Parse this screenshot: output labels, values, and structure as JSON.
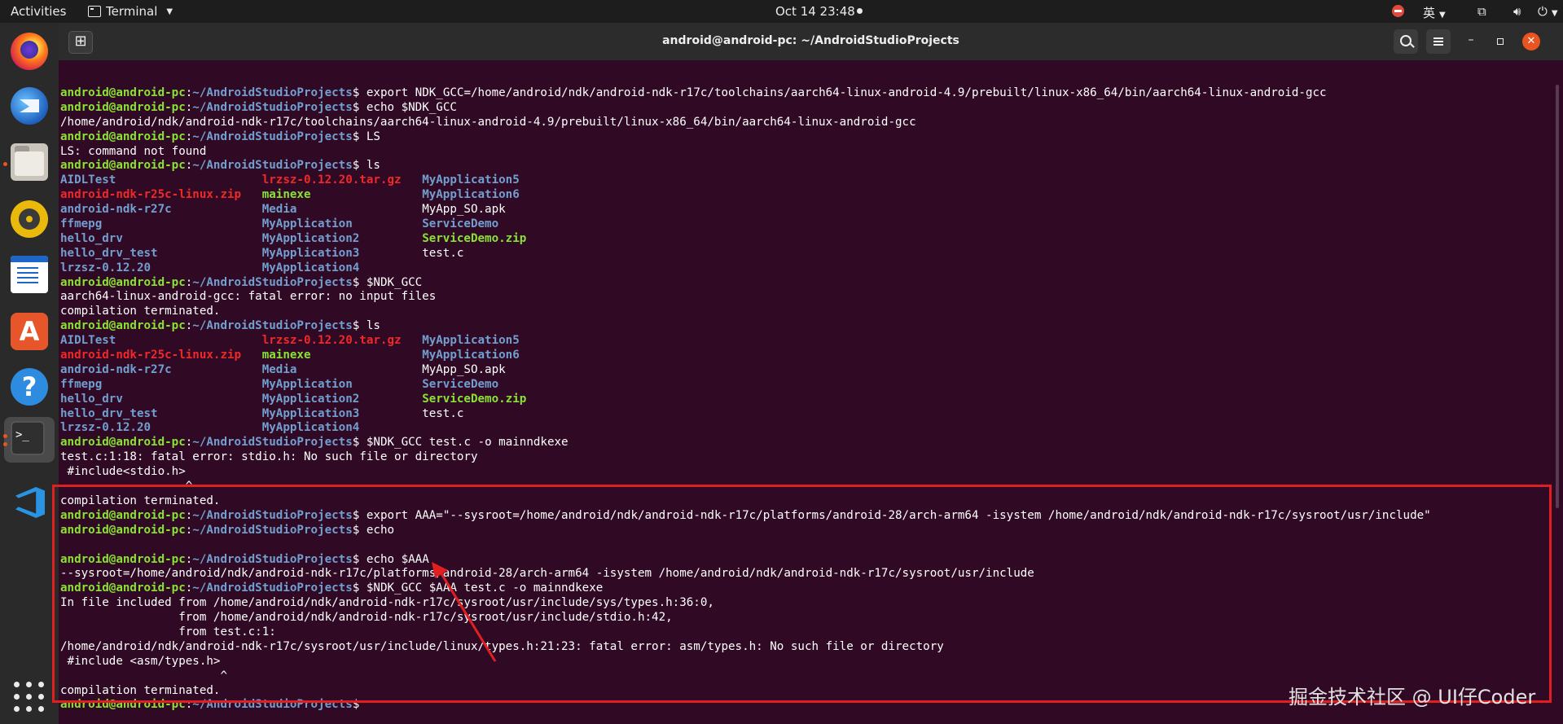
{
  "topbar": {
    "activities": "Activities",
    "app_name": "Terminal",
    "clock": "Oct 14  23:48",
    "ime": "英"
  },
  "dock": {
    "items": [
      "firefox",
      "thunderbird",
      "files",
      "rhythmbox",
      "libreoffice-writer",
      "ubuntu-software",
      "help",
      "terminal",
      "vscode",
      "show-applications"
    ]
  },
  "window": {
    "title": "android@android-pc: ~/AndroidStudioProjects"
  },
  "prompt": {
    "user": "android@android-pc",
    "sep": ":",
    "path": "~/AndroidStudioProjects",
    "dollar": "$ "
  },
  "terminal": {
    "lines": [
      {
        "kind": "prompt",
        "cmd": "export NDK_GCC=/home/android/ndk/android-ndk-r17c/toolchains/aarch64-linux-android-4.9/prebuilt/linux-x86_64/bin/aarch64-linux-android-gcc"
      },
      {
        "kind": "prompt",
        "cmd": "echo $NDK_GCC"
      },
      {
        "kind": "out",
        "text": "/home/android/ndk/android-ndk-r17c/toolchains/aarch64-linux-android-4.9/prebuilt/linux-x86_64/bin/aarch64-linux-android-gcc"
      },
      {
        "kind": "prompt",
        "cmd": "LS"
      },
      {
        "kind": "out",
        "text": "LS: command not found"
      },
      {
        "kind": "prompt",
        "cmd": "ls"
      },
      {
        "kind": "cols",
        "cells": [
          [
            "AIDLTest",
            "dir"
          ],
          [
            "lrzsz-0.12.20.tar.gz",
            "arc"
          ],
          [
            "MyApplication5",
            "dir"
          ]
        ]
      },
      {
        "kind": "cols",
        "cells": [
          [
            "android-ndk-r25c-linux.zip",
            "arc"
          ],
          [
            "mainexe",
            "exe"
          ],
          [
            "MyApplication6",
            "dir"
          ]
        ]
      },
      {
        "kind": "cols",
        "cells": [
          [
            "android-ndk-r27c",
            "dir"
          ],
          [
            "Media",
            "dir"
          ],
          [
            "MyApp_SO.apk",
            "plain"
          ]
        ]
      },
      {
        "kind": "cols",
        "cells": [
          [
            "ffmepg",
            "dir"
          ],
          [
            "MyApplication",
            "dir"
          ],
          [
            "ServiceDemo",
            "dir"
          ]
        ]
      },
      {
        "kind": "cols",
        "cells": [
          [
            "hello_drv",
            "dir"
          ],
          [
            "MyApplication2",
            "dir"
          ],
          [
            "ServiceDemo.zip",
            "exe"
          ]
        ]
      },
      {
        "kind": "cols",
        "cells": [
          [
            "hello_drv_test",
            "dir"
          ],
          [
            "MyApplication3",
            "dir"
          ],
          [
            "test.c",
            "plain"
          ]
        ]
      },
      {
        "kind": "cols",
        "cells": [
          [
            "lrzsz-0.12.20",
            "dir"
          ],
          [
            "MyApplication4",
            "dir"
          ]
        ]
      },
      {
        "kind": "prompt",
        "cmd": "$NDK_GCC"
      },
      {
        "kind": "out",
        "text": "aarch64-linux-android-gcc: fatal error: no input files"
      },
      {
        "kind": "out",
        "text": "compilation terminated."
      },
      {
        "kind": "prompt",
        "cmd": "ls"
      },
      {
        "kind": "cols",
        "cells": [
          [
            "AIDLTest",
            "dir"
          ],
          [
            "lrzsz-0.12.20.tar.gz",
            "arc"
          ],
          [
            "MyApplication5",
            "dir"
          ]
        ]
      },
      {
        "kind": "cols",
        "cells": [
          [
            "android-ndk-r25c-linux.zip",
            "arc"
          ],
          [
            "mainexe",
            "exe"
          ],
          [
            "MyApplication6",
            "dir"
          ]
        ]
      },
      {
        "kind": "cols",
        "cells": [
          [
            "android-ndk-r27c",
            "dir"
          ],
          [
            "Media",
            "dir"
          ],
          [
            "MyApp_SO.apk",
            "plain"
          ]
        ]
      },
      {
        "kind": "cols",
        "cells": [
          [
            "ffmepg",
            "dir"
          ],
          [
            "MyApplication",
            "dir"
          ],
          [
            "ServiceDemo",
            "dir"
          ]
        ]
      },
      {
        "kind": "cols",
        "cells": [
          [
            "hello_drv",
            "dir"
          ],
          [
            "MyApplication2",
            "dir"
          ],
          [
            "ServiceDemo.zip",
            "exe"
          ]
        ]
      },
      {
        "kind": "cols",
        "cells": [
          [
            "hello_drv_test",
            "dir"
          ],
          [
            "MyApplication3",
            "dir"
          ],
          [
            "test.c",
            "plain"
          ]
        ]
      },
      {
        "kind": "cols",
        "cells": [
          [
            "lrzsz-0.12.20",
            "dir"
          ],
          [
            "MyApplication4",
            "dir"
          ]
        ]
      },
      {
        "kind": "prompt",
        "cmd": "$NDK_GCC test.c -o mainndkexe"
      },
      {
        "kind": "out",
        "text": "test.c:1:18: fatal error: stdio.h: No such file or directory"
      },
      {
        "kind": "out",
        "text": " #include<stdio.h>"
      },
      {
        "kind": "out",
        "text": "                  ^"
      },
      {
        "kind": "out",
        "text": "compilation terminated."
      },
      {
        "kind": "prompt",
        "cmd": "export AAA=\"--sysroot=/home/android/ndk/android-ndk-r17c/platforms/android-28/arch-arm64 -isystem /home/android/ndk/android-ndk-r17c/sysroot/usr/include\""
      },
      {
        "kind": "prompt",
        "cmd": "echo"
      },
      {
        "kind": "out",
        "text": ""
      },
      {
        "kind": "prompt",
        "cmd": "echo $AAA"
      },
      {
        "kind": "out",
        "text": "--sysroot=/home/android/ndk/android-ndk-r17c/platforms/android-28/arch-arm64 -isystem /home/android/ndk/android-ndk-r17c/sysroot/usr/include"
      },
      {
        "kind": "prompt",
        "cmd": "$NDK_GCC $AAA test.c -o mainndkexe"
      },
      {
        "kind": "out",
        "text": "In file included from /home/android/ndk/android-ndk-r17c/sysroot/usr/include/sys/types.h:36:0,"
      },
      {
        "kind": "out",
        "text": "                 from /home/android/ndk/android-ndk-r17c/sysroot/usr/include/stdio.h:42,"
      },
      {
        "kind": "out",
        "text": "                 from test.c:1:"
      },
      {
        "kind": "out",
        "text": "/home/android/ndk/android-ndk-r17c/sysroot/usr/include/linux/types.h:21:23: fatal error: asm/types.h: No such file or directory"
      },
      {
        "kind": "out",
        "text": " #include <asm/types.h>"
      },
      {
        "kind": "out",
        "text": "                       ^"
      },
      {
        "kind": "out",
        "text": "compilation terminated."
      },
      {
        "kind": "prompt",
        "cmd": ""
      }
    ]
  },
  "annotation": {
    "highlight_color": "#e02020"
  },
  "watermark": "掘金技术社区 @ UI仔Coder",
  "colors": {
    "terminal_bg": "#300a24",
    "prompt_user": "#8ae234",
    "prompt_path": "#729fcf",
    "archive": "#ef2929",
    "executable": "#8ae234",
    "directory": "#729fcf"
  }
}
